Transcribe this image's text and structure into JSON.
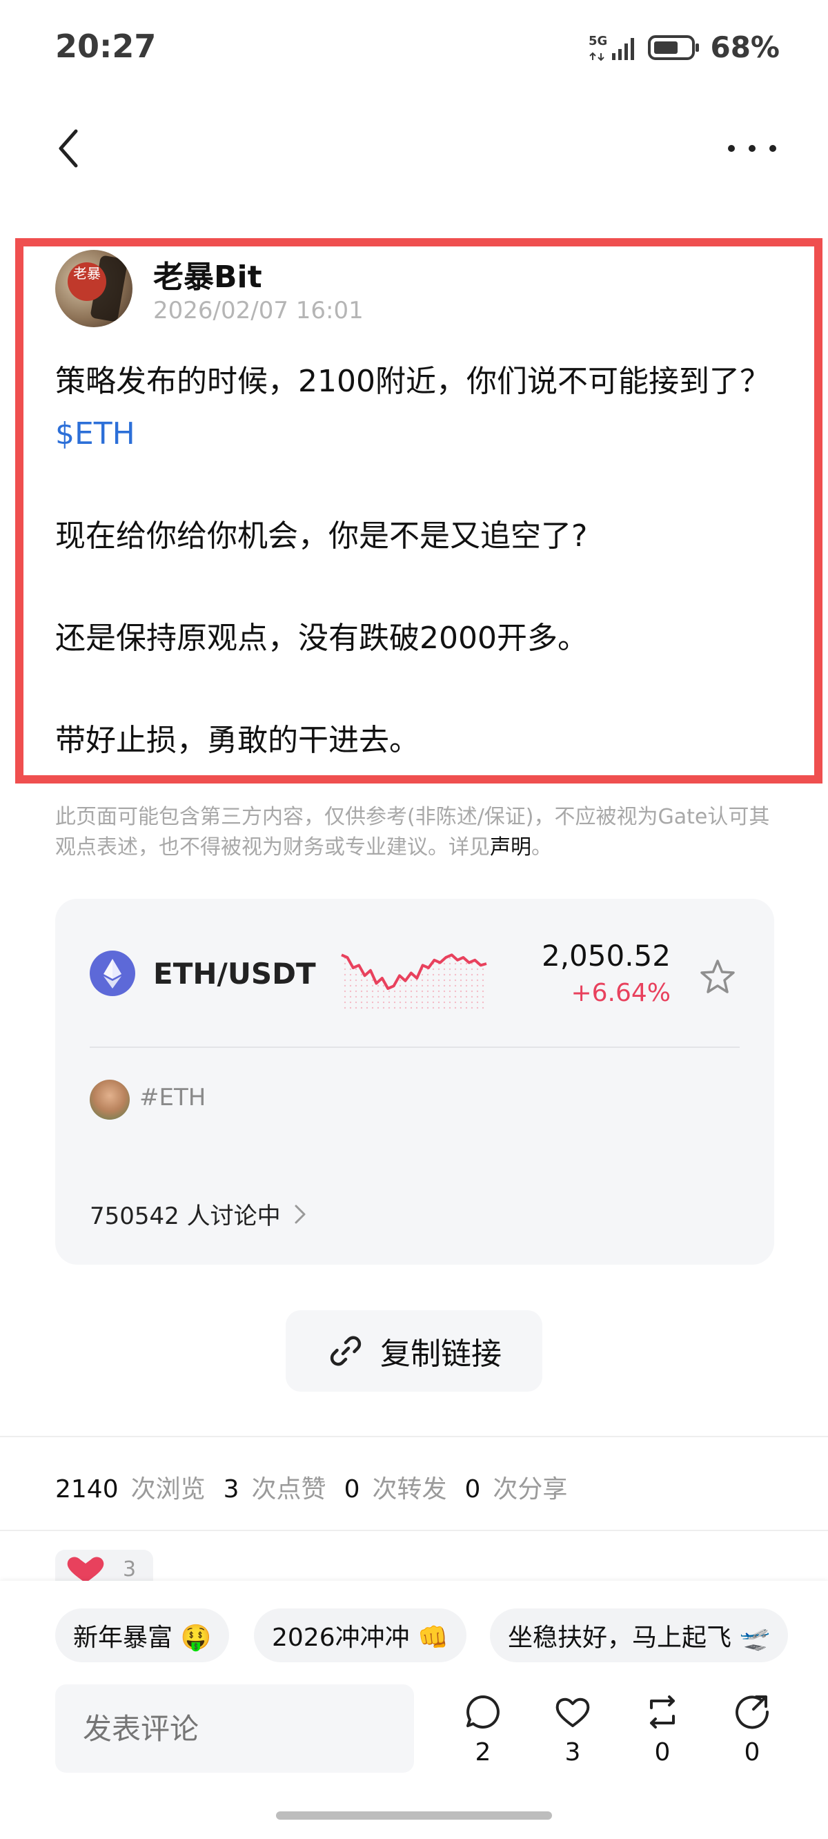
{
  "status_bar": {
    "time": "20:27",
    "network": "5G",
    "battery_percent": "68%",
    "battery_level": 0.68
  },
  "post": {
    "author": "老暴Bit",
    "avatar_text": "老暴",
    "timestamp": "2026/02/07 16:01",
    "line1": "策略发布的时候，2100附近，你们说不可能接到了？",
    "ticker_link": "$ETH",
    "line2": "现在给你给你机会，你是不是又追空了?",
    "line3": "还是保持原观点，没有跌破2000开多。",
    "line4": "带好止损，勇敢的干进去。"
  },
  "disclaimer": {
    "text": "此页面可能包含第三方内容，仅供参考(非陈述/保证)，不应被视为Gate认可其观点表述，也不得被视为财务或专业建议。详见",
    "link": "声明",
    "end": "。"
  },
  "market_card": {
    "pair": "ETH/USDT",
    "price": "2,050.52",
    "change": "+6.64%",
    "topic": "#ETH",
    "discussion": "750542 人讨论中",
    "sparkline_color": "#e8415d"
  },
  "copy_link": {
    "label": "复制链接"
  },
  "stats": {
    "views": "2140",
    "views_label": "次浏览",
    "likes": "3",
    "likes_label": "次点赞",
    "reposts": "0",
    "reposts_label": "次转发",
    "shares": "0",
    "shares_label": "次分享"
  },
  "reactions": {
    "heart_count": "3"
  },
  "quick_replies": [
    {
      "label": "新年暴富 🤑"
    },
    {
      "label": "2026冲冲冲 👊"
    },
    {
      "label": "坐稳扶好，马上起飞 🛫"
    }
  ],
  "comment_bar": {
    "placeholder": "发表评论",
    "comment_count": "2",
    "like_count": "3",
    "repost_count": "0",
    "share_count": "0"
  }
}
